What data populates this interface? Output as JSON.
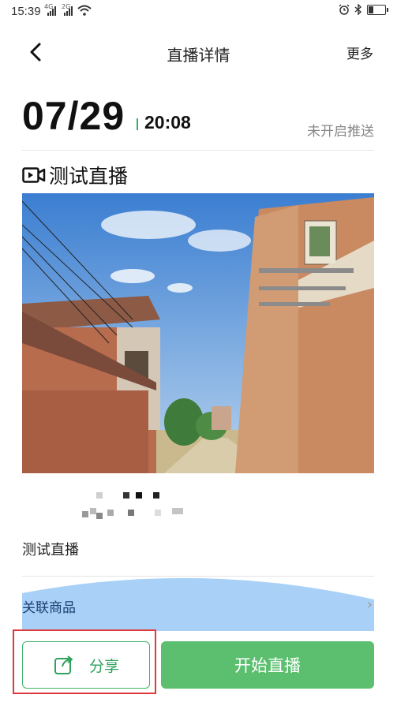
{
  "status_bar": {
    "time": "15:39",
    "signal_1_label": "4G",
    "signal_2_label": "2G",
    "icons": [
      "alarm-icon",
      "bluetooth-icon",
      "battery-icon"
    ]
  },
  "header": {
    "back_icon": "chevron-left-icon",
    "title": "直播详情",
    "more_label": "更多"
  },
  "schedule": {
    "date": "07/29",
    "time": "20:08",
    "push_status": "未开启推送"
  },
  "live": {
    "icon": "video-camera-icon",
    "title": "测试直播",
    "description": "测试直播"
  },
  "related_products": {
    "label": "关联商品",
    "chevron": "chevron-right-icon"
  },
  "actions": {
    "share_label": "分享",
    "share_icon": "share-icon",
    "start_label": "开始直播"
  },
  "colors": {
    "accent_green": "#5bbf6f",
    "highlight_red": "#e0393b",
    "related_blue": "#a9d1f7"
  }
}
